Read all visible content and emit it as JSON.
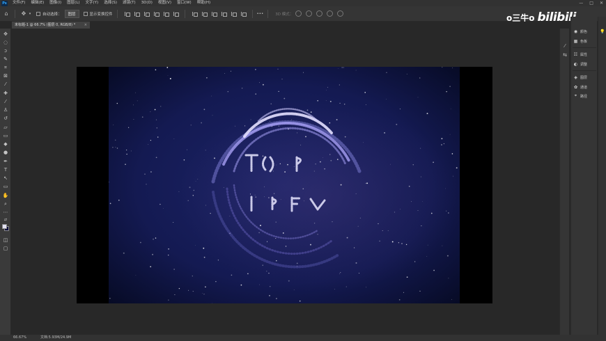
{
  "app": {
    "logo": "Ps"
  },
  "menu": [
    "文件(F)",
    "编辑(E)",
    "图像(I)",
    "图层(L)",
    "文字(Y)",
    "选择(S)",
    "滤镜(T)",
    "3D(D)",
    "视图(V)",
    "窗口(W)",
    "帮助(H)"
  ],
  "window_controls": [
    "—",
    "□",
    "✕"
  ],
  "options": {
    "auto_select_label": "自动选择：",
    "auto_select_value": "图层",
    "show_transform_label": "显示变换控件",
    "more": "•••",
    "mode_3d_label": "3D 模式："
  },
  "watermark": {
    "user": "o三牛o",
    "site": "bilibili"
  },
  "document": {
    "tab_label": "未标题-1 @ 66.7% (图层 0, RGB/8) *",
    "close": "×"
  },
  "status": {
    "zoom": "66.67%",
    "doc_info": "文档:5.93M/24.9M"
  },
  "panels": {
    "group1": [
      "颜色",
      "色板"
    ],
    "group2": [
      "属性",
      "调整"
    ],
    "group3": [
      "图层",
      "通道",
      "路径"
    ]
  },
  "colors": {
    "canvas_bg": "#000000",
    "sky_center": "#1c2468",
    "sky_edge": "#070b26",
    "foreground_swatch": "#e2e1f2",
    "background_swatch": "#0b0b3a"
  }
}
